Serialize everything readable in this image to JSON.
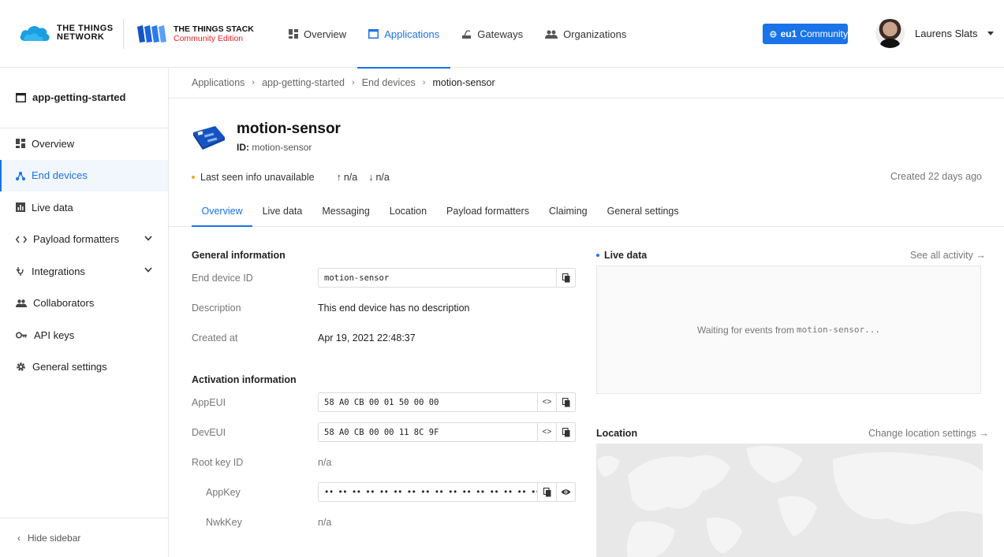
{
  "header": {
    "brand1": [
      "THE THINGS",
      "NETWORK"
    ],
    "brand2_title": "THE THINGS STACK",
    "brand2_subtitle": "Community Edition",
    "nav": [
      {
        "label": "Overview",
        "icon": "dashboard-icon"
      },
      {
        "label": "Applications",
        "icon": "application-icon",
        "active": true
      },
      {
        "label": "Gateways",
        "icon": "gateway-icon"
      },
      {
        "label": "Organizations",
        "icon": "organization-icon"
      }
    ],
    "cluster_region": "eu1",
    "cluster_label": "Community",
    "user_name": "Laurens Slats"
  },
  "sidebar": {
    "app_name": "app-getting-started",
    "items": [
      {
        "label": "Overview",
        "icon": "dashboard-icon"
      },
      {
        "label": "End devices",
        "icon": "device-icon",
        "active": true
      },
      {
        "label": "Live data",
        "icon": "chart-icon"
      },
      {
        "label": "Payload formatters",
        "icon": "code-icon",
        "expandable": true
      },
      {
        "label": "Integrations",
        "icon": "integration-icon",
        "expandable": true
      },
      {
        "label": "Collaborators",
        "icon": "people-icon"
      },
      {
        "label": "API keys",
        "icon": "key-icon"
      },
      {
        "label": "General settings",
        "icon": "gear-icon"
      }
    ],
    "hide_label": "Hide sidebar"
  },
  "breadcrumbs": [
    "Applications",
    "app-getting-started",
    "End devices",
    "motion-sensor"
  ],
  "device": {
    "name": "motion-sensor",
    "id_label": "ID:",
    "id": "motion-sensor",
    "last_seen": "Last seen info unavailable",
    "uplink": "n/a",
    "downlink": "n/a",
    "created": "Created 22 days ago"
  },
  "tabs": [
    "Overview",
    "Live data",
    "Messaging",
    "Location",
    "Payload formatters",
    "Claiming",
    "General settings"
  ],
  "general": {
    "title": "General information",
    "end_device_id_label": "End device ID",
    "end_device_id": "motion-sensor",
    "description_label": "Description",
    "description": "This end device has no description",
    "created_at_label": "Created at",
    "created_at": "Apr 19, 2021 22:48:37"
  },
  "activation": {
    "title": "Activation information",
    "appeui_label": "AppEUI",
    "appeui": "58 A0 CB 00 01 50 00 00",
    "deveui_label": "DevEUI",
    "deveui": "58 A0 CB 00 00 11 8C 9F",
    "root_key_id_label": "Root key ID",
    "root_key_id": "n/a",
    "appkey_label": "AppKey",
    "appkey": "•• •• •• •• •• •• •• •• •• •• •• •• •• •• •• ••",
    "nwkkey_label": "NwkKey",
    "nwkkey": "n/a"
  },
  "live_panel": {
    "title": "Live data",
    "link": "See all activity →",
    "waiting_prefix": "Waiting for events from ",
    "waiting_device": "motion-sensor",
    "waiting_suffix": "..."
  },
  "location_panel": {
    "title": "Location",
    "link": "Change location settings →"
  },
  "colors": {
    "accent": "#1a73e8",
    "brand_red": "#e5232b",
    "status_dot": "#f5a623"
  }
}
